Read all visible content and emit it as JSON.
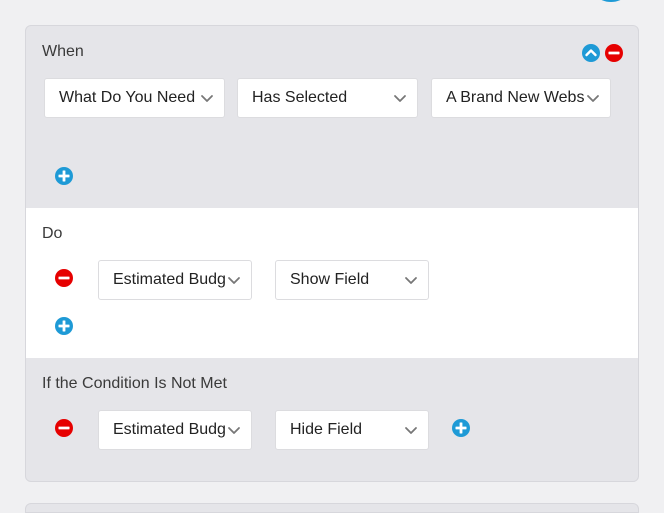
{
  "when": {
    "title": "When",
    "field_select": "What Do You Need",
    "operator_select": "Has Selected",
    "value_select": "A Brand New Webs"
  },
  "do": {
    "title": "Do",
    "field_select": "Estimated Budg",
    "action_select": "Show Field"
  },
  "else": {
    "title": "If the Condition Is Not Met",
    "field_select": "Estimated Budg",
    "action_select": "Hide Field"
  },
  "colors": {
    "remove": "#e60000",
    "add": "#1e9ad6",
    "collapse": "#1e9ad6"
  }
}
